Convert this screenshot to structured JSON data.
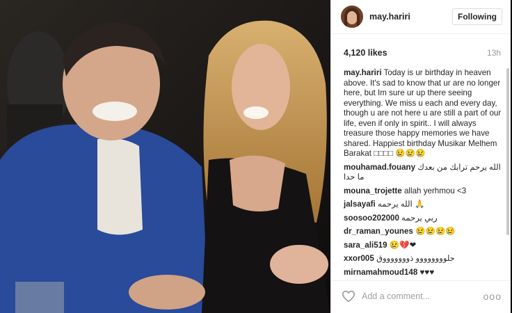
{
  "post": {
    "username": "may.hariri",
    "follow_label": "Following",
    "likes": "4,120 likes",
    "time": "13h",
    "caption": {
      "user": "may.hariri",
      "text": "Today is ur birthday in heaven above. It's sad to know that ur are no longer here, but Im sure ur up there seeing everything. We miss u each and every day, though u are not here u are still a part of our life, even if only in spirit.. I will always treasure those happy memories we have shared. Happiest birthday Musikar Melhem Barakat □□□□ 😢😢😢"
    },
    "comments": [
      {
        "user": "mouhamad.fouany",
        "text": "الله يرحم ترابك من بعدك ما حدا"
      },
      {
        "user": "mouna_trojette",
        "text": "allah yerhmou <3"
      },
      {
        "user": "jalsayafi",
        "text": "الله يرحمه 🙏"
      },
      {
        "user": "soosoo202000",
        "text": "ربي يرحمه"
      },
      {
        "user": "dr_raman_younes",
        "text": "😢😢😢😢"
      },
      {
        "user": "sara_ali519",
        "text": "😢💔❤"
      },
      {
        "user": "xxor005",
        "text": "حلوووووووو ذوووووووق"
      },
      {
        "user": "mirnamahmoud148",
        "text": "♥♥♥"
      }
    ],
    "comment_placeholder": "Add a comment...",
    "more_label": "ooo"
  },
  "icons": {
    "like": "heart-outline-icon",
    "more": "more-options-icon"
  },
  "colors": {
    "username": "#262626",
    "muted": "#999999",
    "border": "#efefef"
  }
}
